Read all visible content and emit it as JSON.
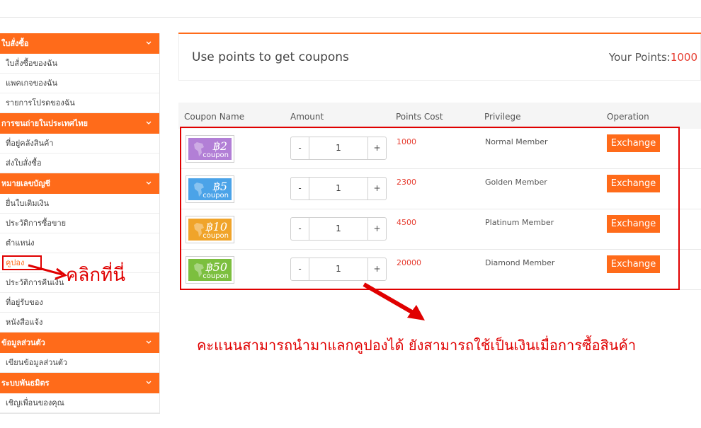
{
  "sidebar": {
    "sections": [
      {
        "title": "ใบสั่งซื้อ",
        "items": [
          "ใบสั่งซื้อของฉัน",
          "แพคเกจของฉัน",
          "รายการโปรดของฉัน"
        ]
      },
      {
        "title": "การขนถ่ายในประเทศไทย",
        "items": [
          "ที่อยู่คลังสินค้า",
          "ส่งใบสั่งซื้อ"
        ]
      },
      {
        "title": "หมายเลขบัญชี",
        "items": [
          "ยื่นใบเติมเงิน",
          "ประวัติการซื้อขาย",
          "ตำแหน่ง",
          "คูปอง",
          "ประวัติการคืนเงิน",
          "ที่อยู่รับของ",
          "หนังสือแจ้ง"
        ]
      },
      {
        "title": "ข้อมูลส่วนตัว",
        "items": [
          "เขียนข้อมูลส่วนตัว"
        ]
      },
      {
        "title": "ระบบพันธมิตร",
        "items": [
          "เชิญเพื่อนของคุณ"
        ]
      }
    ],
    "active_item": "คูปอง"
  },
  "annotation": {
    "click_here": "คลิกที่นี่",
    "note": "คะแนนสามารถนำมาแลกคูปองได้ ยังสามารถใช้เป็นเงินเมื่อการซื้อสินค้า"
  },
  "panel": {
    "title": "Use points to get coupons",
    "points_label": "Your Points:",
    "points_value": "1000"
  },
  "table": {
    "headers": [
      "Coupon Name",
      "Amount",
      "Points Cost",
      "Privilege",
      "Operation"
    ],
    "rows": [
      {
        "coupon_amount": "฿2",
        "coupon_label": "coupon",
        "coupon_color": "#b27fd6",
        "minus": "-",
        "qty": "1",
        "plus": "+",
        "points_cost": "1000",
        "privilege": "Normal Member",
        "action": "Exchange"
      },
      {
        "coupon_amount": "฿5",
        "coupon_label": "coupon",
        "coupon_color": "#4ba3e8",
        "minus": "-",
        "qty": "1",
        "plus": "+",
        "points_cost": "2300",
        "privilege": "Golden Member",
        "action": "Exchange"
      },
      {
        "coupon_amount": "฿10",
        "coupon_label": "coupon",
        "coupon_color": "#f0a42a",
        "minus": "-",
        "qty": "1",
        "plus": "+",
        "points_cost": "4500",
        "privilege": "Platinum Member",
        "action": "Exchange"
      },
      {
        "coupon_amount": "฿50",
        "coupon_label": "coupon",
        "coupon_color": "#7cbf3f",
        "minus": "-",
        "qty": "1",
        "plus": "+",
        "points_cost": "20000",
        "privilege": "Diamond Member",
        "action": "Exchange"
      }
    ]
  },
  "colors": {
    "accent": "#ff6b1a",
    "annotation_red": "#e00000",
    "cost_red": "#e63b2e"
  }
}
